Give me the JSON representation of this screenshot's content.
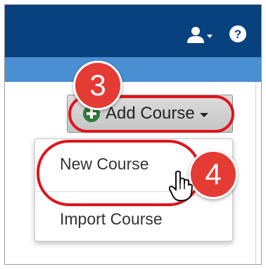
{
  "header": {
    "background_color": "#07427e",
    "user_menu_icon": "user-icon",
    "help_icon": "question-circle-icon",
    "help_glyph": "?"
  },
  "subheader": {
    "background_color": "#4a8fd1"
  },
  "add_course": {
    "label": "Add Course",
    "icon": "plus-circle-icon"
  },
  "dropdown": {
    "items": [
      {
        "label": "New Course"
      },
      {
        "label": "Import Course"
      }
    ]
  },
  "callouts": [
    {
      "number": "3"
    },
    {
      "number": "4"
    }
  ],
  "colors": {
    "callout_red": "#e53b35",
    "highlight_ring": "#e0141c",
    "plus_green": "#2f7a36"
  }
}
